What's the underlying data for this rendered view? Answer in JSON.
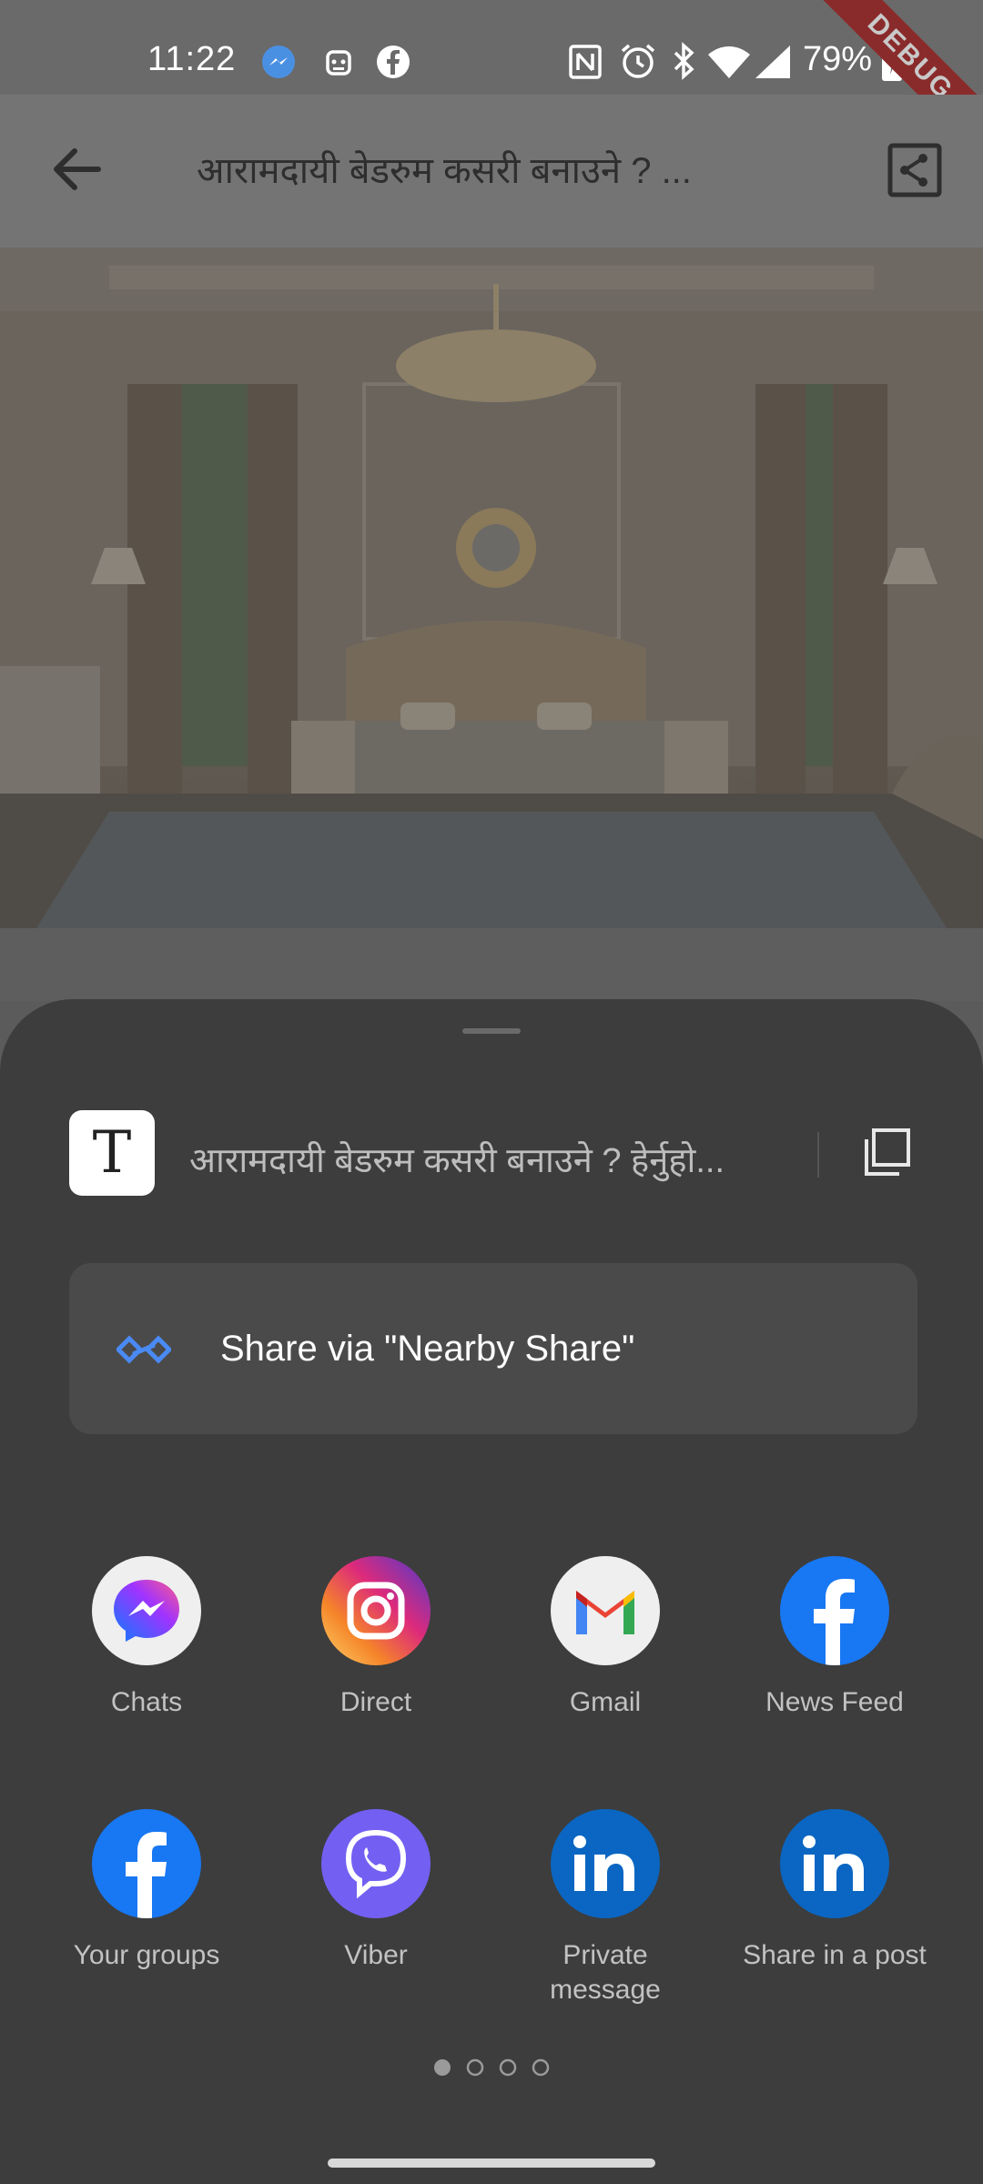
{
  "status_bar": {
    "time": "11:22",
    "battery": "79%",
    "left_icons": [
      "messenger-icon",
      "robot-icon",
      "facebook-icon"
    ],
    "right_icons": [
      "nfc-icon",
      "alarm-icon",
      "bluetooth-icon",
      "wifi-icon",
      "signal-icon",
      "battery-icon"
    ],
    "debug_banner": "DEBUG"
  },
  "app_bar": {
    "title": "आरामदायी बेडरुम कसरी बनाउने ? ...",
    "back_icon": "arrow-left-icon",
    "share_icon": "share-icon"
  },
  "article": {
    "image": "bedroom-photo"
  },
  "share_sheet": {
    "preview_text": "आरामदायी बेडरुम कसरी बनाउने ? हेर्नुहो...",
    "preview_glyph": "T",
    "copy_icon": "copy-icon",
    "nearby_label": "Share via \"Nearby Share\"",
    "nearby_icon": "nearby-share-icon",
    "apps": [
      {
        "label": "Chats",
        "icon": "messenger-icon"
      },
      {
        "label": "Direct",
        "icon": "instagram-icon"
      },
      {
        "label": "Gmail",
        "icon": "gmail-icon"
      },
      {
        "label": "News Feed",
        "icon": "facebook-icon"
      },
      {
        "label": "Your groups",
        "icon": "facebook-icon"
      },
      {
        "label": "Viber",
        "icon": "viber-icon"
      },
      {
        "label": "Private message",
        "icon": "linkedin-icon"
      },
      {
        "label": "Share in a post",
        "icon": "linkedin-icon"
      }
    ],
    "page_indicator": {
      "current": 1,
      "total": 4
    }
  },
  "colors": {
    "sheet_bg": "#3d3d3d",
    "facebook": "#1877f2",
    "linkedin": "#0a66c2",
    "viber": "#7360f2",
    "nearby_accent": "#4a8af4"
  }
}
